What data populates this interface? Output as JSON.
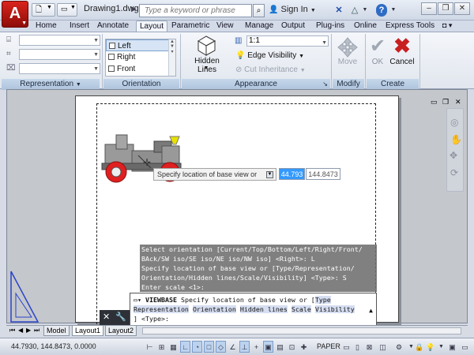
{
  "titlebar": {
    "app_letter": "A",
    "doc_title": "Drawing1.dwg",
    "search_placeholder": "Type a keyword or phrase",
    "sign_in": "Sign In",
    "help": "?",
    "icons": [
      "new-icon",
      "open-icon",
      "search-icon",
      "user-icon",
      "exchange-icon",
      "a360-icon",
      "help-icon",
      "minimize-icon",
      "restore-icon",
      "close-icon"
    ]
  },
  "tabs": [
    "Home",
    "Insert",
    "Annotate",
    "Layout",
    "Parametric",
    "View",
    "Manage",
    "Output",
    "Plug-ins",
    "Online",
    "Express Tools"
  ],
  "active_tab": "Layout",
  "ribbon": {
    "panels": {
      "representation": "Representation",
      "orientation": "Orientation",
      "appearance": "Appearance",
      "modify": "Modify",
      "create": "Create"
    },
    "orientation_items": [
      "Left",
      "Right",
      "Front"
    ],
    "selected_orientation": "Left",
    "hidden_lines_label": "Hidden Lines",
    "scale_value": "1:1",
    "edge_visibility": "Edge Visibility",
    "cut_inheritance": "Cut Inheritance",
    "move_label": "Move",
    "ok_label": "OK",
    "cancel_label": "Cancel"
  },
  "canvas": {
    "tooltip_prompt": "Specify location of base view or",
    "coord_x": "44.793",
    "coord_y": "144.8473"
  },
  "command_history": [
    "Select orientation [Current/Top/Bottom/Left/Right/Front/",
    "BAck/SW iso/SE iso/NE iso/NW iso] <Right>: L",
    "Specify location of base view or [Type/Representation/",
    "Orientation/Hidden lines/Scale/Visibility] <Type>: S",
    "Enter scale <1>:"
  ],
  "command_line": {
    "command": "VIEWBASE",
    "prompt": "Specify location of base view or [",
    "options": [
      "Type",
      "Representation",
      "Orientation",
      "Hidden lines",
      "Scale",
      "Visibility"
    ],
    "default": "] <Type>:"
  },
  "layout_tabs": [
    "Model",
    "Layout1",
    "Layout2"
  ],
  "active_layout": "Layout1",
  "status": {
    "coords": "44.7930, 144.8473, 0.0000",
    "paper": "PAPER"
  },
  "colors": {
    "app_red": "#c0140e",
    "wheel_red": "#e02020",
    "selection_blue": "#3399ff",
    "cancel_red": "#c82020",
    "ok_gray": "#a0a8b4"
  }
}
